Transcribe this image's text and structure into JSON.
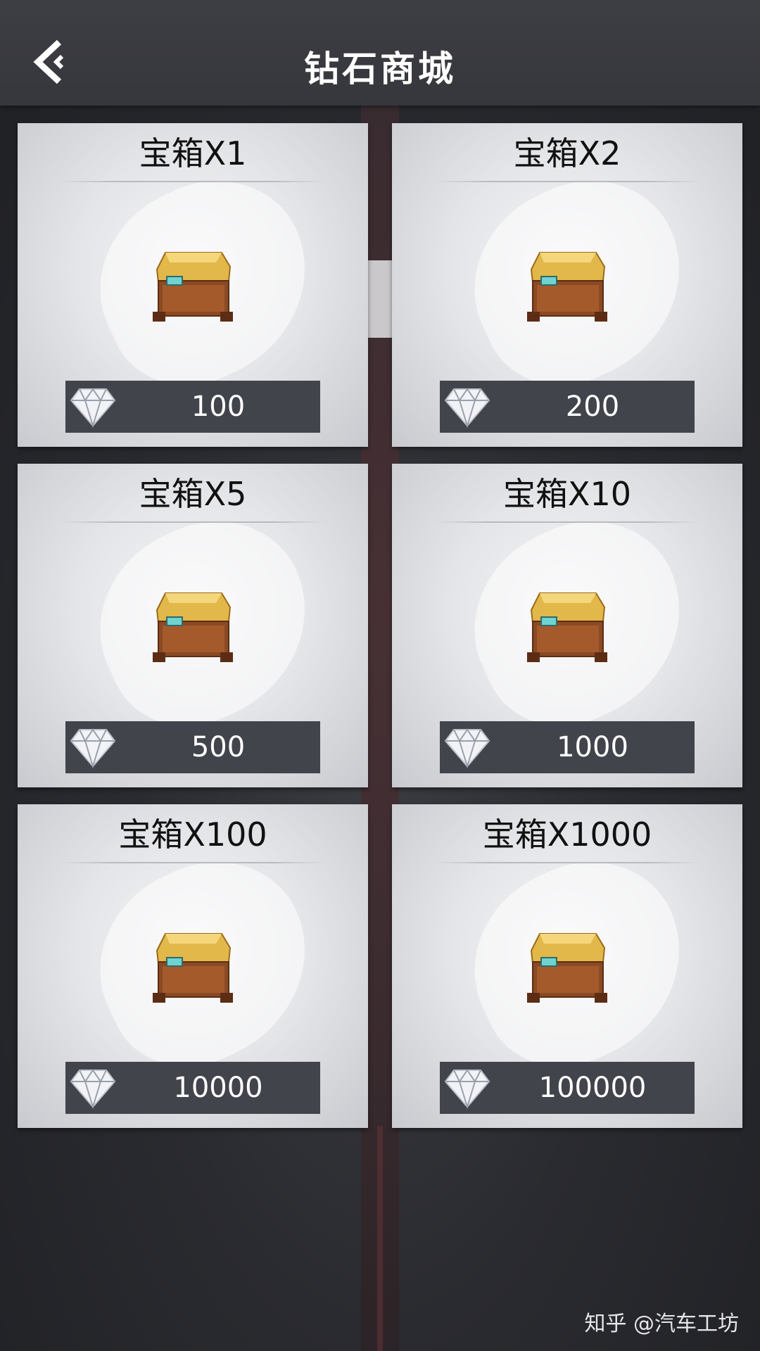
{
  "header": {
    "title": "钻石商城",
    "back_icon": "back-chevron-icon"
  },
  "products": [
    {
      "title": "宝箱X1",
      "price": "100"
    },
    {
      "title": "宝箱X2",
      "price": "200"
    },
    {
      "title": "宝箱X5",
      "price": "500"
    },
    {
      "title": "宝箱X10",
      "price": "1000"
    },
    {
      "title": "宝箱X100",
      "price": "10000"
    },
    {
      "title": "宝箱X1000",
      "price": "100000"
    }
  ],
  "watermark": "知乎 @汽车工坊",
  "colors": {
    "header_bg": "#3d3e44",
    "price_bar": "#42444c",
    "chest_gold": "#e2b84a"
  }
}
